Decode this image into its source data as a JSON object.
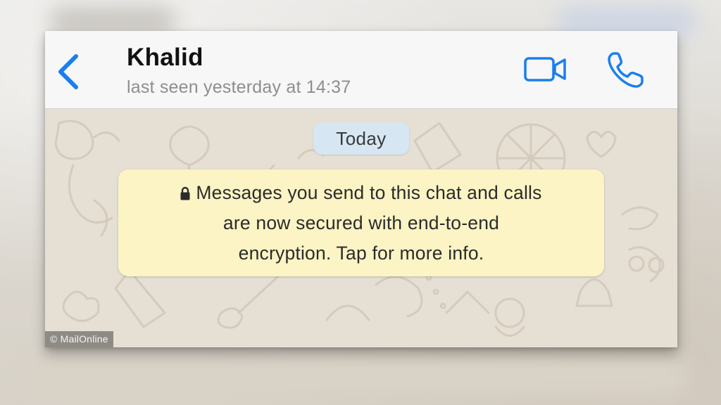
{
  "header": {
    "contact_name": "Khalid",
    "last_seen": "last seen yesterday at 14:37",
    "back_icon": "chevron-left-icon",
    "video_icon": "video-camera-icon",
    "call_icon": "phone-icon"
  },
  "chat": {
    "date_label": "Today",
    "system_message": {
      "icon": "lock-icon",
      "lines": [
        "Messages you send to this chat and calls",
        "are now secured with end-to-end",
        "encryption. Tap for more info."
      ]
    }
  },
  "watermark": "© MailOnline",
  "colors": {
    "accent": "#1a7ef0",
    "system_bubble": "#fcf4c4",
    "date_pill": "#d6e6f3",
    "chat_background": "#e6dfd3"
  }
}
